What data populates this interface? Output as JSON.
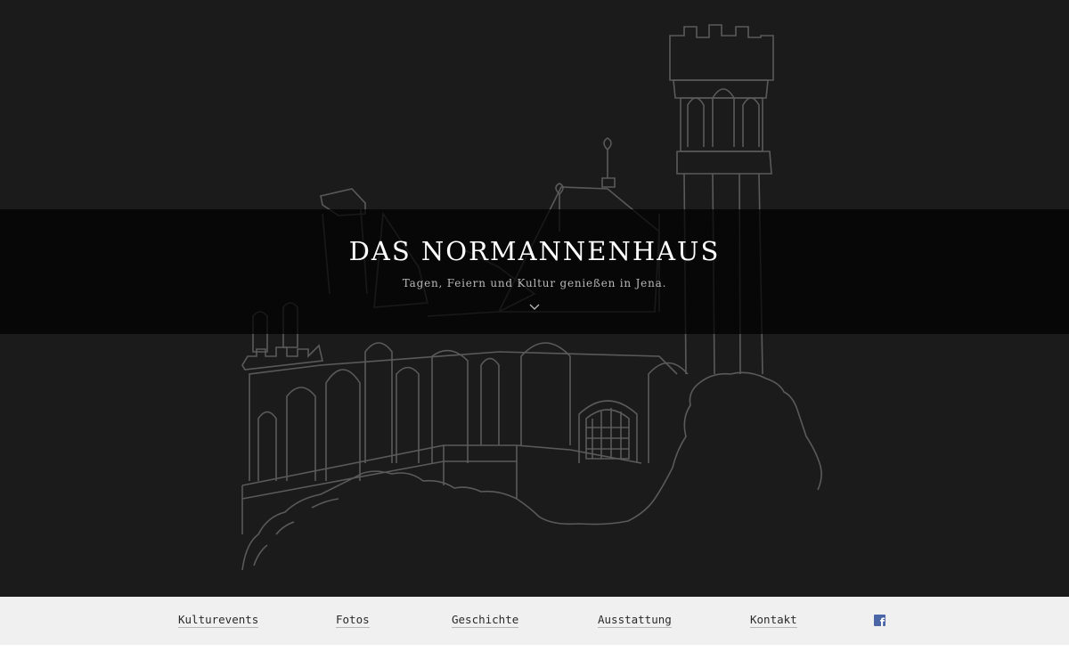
{
  "hero": {
    "title": "DAS NORMANNENHAUS",
    "subtitle": "Tagen, Feiern und Kultur genießen in Jena.",
    "scroll_icon": "chevron-down-icon",
    "illustration": "castle-line-drawing"
  },
  "nav": {
    "items": [
      {
        "label": "Kulturevents"
      },
      {
        "label": "Fotos"
      },
      {
        "label": "Geschichte"
      },
      {
        "label": "Ausstattung"
      },
      {
        "label": "Kontakt"
      }
    ],
    "social_icon": "facebook-icon"
  },
  "colors": {
    "hero_bg": "#1b1b1b",
    "band_bg": "#000000",
    "line_art": "#5e5e5e",
    "nav_bg": "#f0f0f0",
    "facebook": "#4a66a6"
  }
}
